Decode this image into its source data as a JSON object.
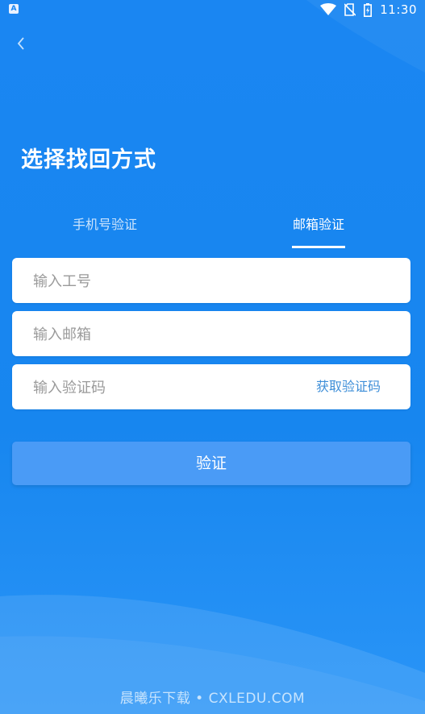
{
  "status_bar": {
    "left_icon_letter": "A",
    "time": "11:30",
    "icons": [
      "wifi-icon",
      "no-sim-icon",
      "battery-charging-icon"
    ]
  },
  "header": {
    "back_icon": "chevron-left-icon",
    "title": "选择找回方式"
  },
  "tabs": {
    "items": [
      {
        "label": "手机号验证",
        "active": false
      },
      {
        "label": "邮箱验证",
        "active": true
      }
    ]
  },
  "form": {
    "employee_id": {
      "placeholder": "输入工号",
      "value": ""
    },
    "email": {
      "placeholder": "输入邮箱",
      "value": ""
    },
    "code": {
      "placeholder": "输入验证码",
      "value": "",
      "get_code_label": "获取验证码"
    },
    "submit_label": "验证"
  },
  "watermark": "晨曦乐下载 • CXLEDU.COM",
  "colors": {
    "background": "#1a86f2",
    "button": "#4a9bf6",
    "link": "#3f8fd8"
  }
}
